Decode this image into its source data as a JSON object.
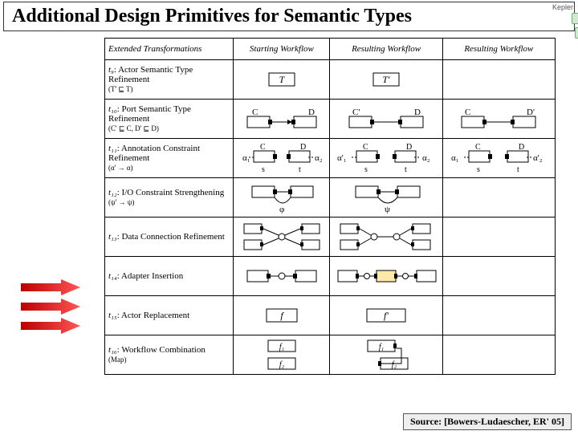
{
  "title": "Additional Design Primitives for Semantic Types",
  "logo_text": "Kepler",
  "headers": {
    "h1": "Extended Transformations",
    "h2": "Starting Workflow",
    "h3": "Resulting Workflow",
    "h4": "Resulting Workflow"
  },
  "rows": {
    "r9": {
      "id": "t₉",
      "name": ": Actor Semantic Type Refinement",
      "cond": "(T' ⊑ T)",
      "start": "T",
      "result": "T'"
    },
    "r10": {
      "id": "t₁₀",
      "name": ": Port Semantic Type Refinement",
      "cond": "(C' ⊑ C, D' ⊑ D)",
      "c": "C",
      "d": "D",
      "cp": "C'",
      "dp": "D'"
    },
    "r11": {
      "id": "t₁₁",
      "name": ": Annotation Constraint Refinement",
      "cond": "(α' → α)",
      "a1": "α₁",
      "a2": "α₂",
      "a1p": "α'₁",
      "a2p": "α'₂",
      "s": "s",
      "t": "t",
      "c": "C",
      "d": "D"
    },
    "r12": {
      "id": "t₁₂",
      "name": ": I/O Constraint Strengthening",
      "cond": "(ψ' → ψ)",
      "phi": "φ",
      "psi": "ψ"
    },
    "r13": {
      "id": "t₁₃",
      "name": ": Data Connection Refinement"
    },
    "r14": {
      "id": "t₁₄",
      "name": ": Adapter Insertion"
    },
    "r15": {
      "id": "t₁₅",
      "name": ": Actor Replacement",
      "f": "f",
      "fp": "f'"
    },
    "r16": {
      "id": "t₁₆",
      "name": ": Workflow Combination",
      "sub": "(Map)",
      "f1": "f₁",
      "f2": "f₂"
    }
  },
  "source": "Source: [Bowers-Ludaescher, ER' 05]"
}
